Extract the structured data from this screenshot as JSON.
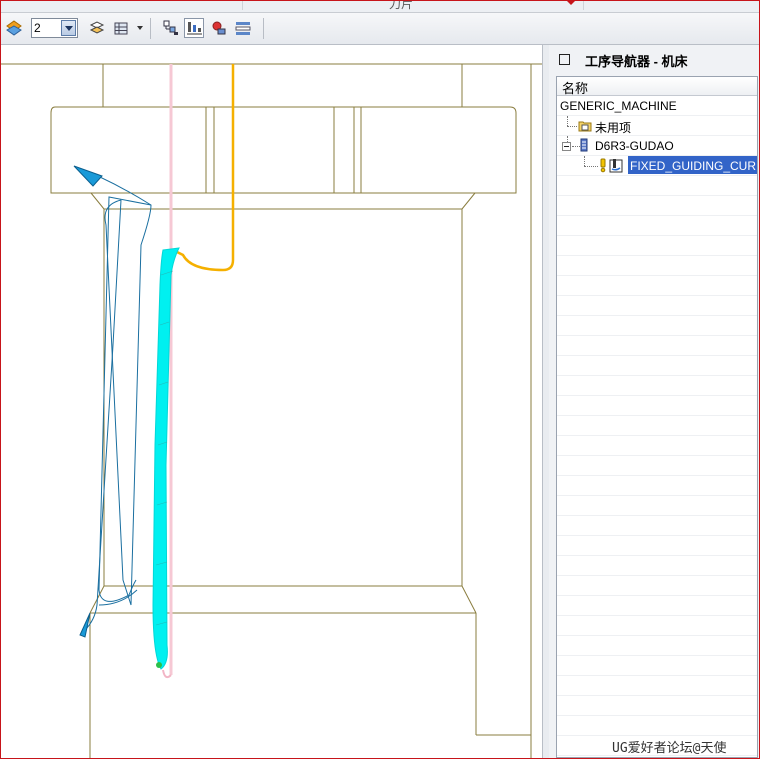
{
  "top_strip": {
    "caption": "刀片"
  },
  "toolbar": {
    "layer_value": "2",
    "icons": [
      "layer-orient-icon",
      "combo-dropdown",
      "display-mode-icon",
      "table-view-icon",
      "program-order-view-icon",
      "machine-tool-view-icon",
      "geometry-view-icon",
      "method-view-icon"
    ]
  },
  "navigator": {
    "title": "工序导航器 - 机床",
    "column_header": "名称",
    "items": [
      {
        "label": "GENERIC_MACHINE"
      },
      {
        "label": "未用项"
      },
      {
        "label": "D6R3-GUDAO"
      },
      {
        "label": "FIXED_GUIDING_CUR..."
      }
    ]
  },
  "watermark": "UG爱好者论坛@天使",
  "colors": {
    "part_outline": "#8a7d3f",
    "tool_axis": "#f5b000",
    "toolpath": "#00f0f0",
    "approach": "#1a6fa0",
    "selection": "#3264c8",
    "frame": "#c7141a"
  }
}
